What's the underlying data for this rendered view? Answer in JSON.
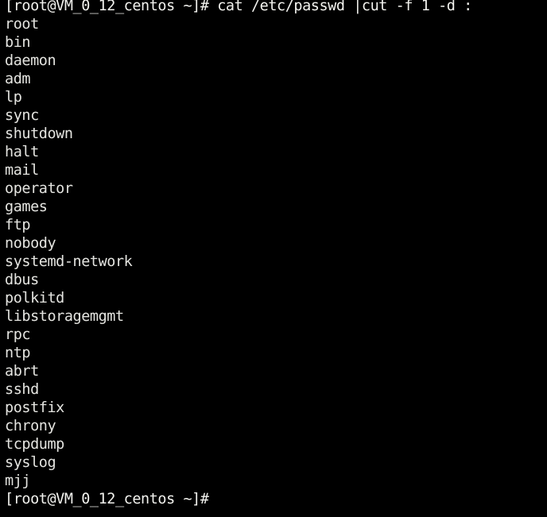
{
  "terminal": {
    "app_name": "terminal",
    "background_color": "#000000",
    "foreground_color": "#e8e8e4",
    "columns": 62,
    "rows": 28,
    "prompt": "[root@VM_0_12_centos ~]#",
    "user": "root",
    "hostname": "VM_0_12_centos",
    "working_directory": "~",
    "lines": [
      {
        "type": "command",
        "text": "[root@VM_0_12_centos ~]# cat /etc/passwd |cut -f 1 -d :"
      },
      {
        "type": "output",
        "text": "root"
      },
      {
        "type": "output",
        "text": "bin"
      },
      {
        "type": "output",
        "text": "daemon"
      },
      {
        "type": "output",
        "text": "adm"
      },
      {
        "type": "output",
        "text": "lp"
      },
      {
        "type": "output",
        "text": "sync"
      },
      {
        "type": "output",
        "text": "shutdown"
      },
      {
        "type": "output",
        "text": "halt"
      },
      {
        "type": "output",
        "text": "mail"
      },
      {
        "type": "output",
        "text": "operator"
      },
      {
        "type": "output",
        "text": "games"
      },
      {
        "type": "output",
        "text": "ftp"
      },
      {
        "type": "output",
        "text": "nobody"
      },
      {
        "type": "output",
        "text": "systemd-network"
      },
      {
        "type": "output",
        "text": "dbus"
      },
      {
        "type": "output",
        "text": "polkitd"
      },
      {
        "type": "output",
        "text": "libstoragemgmt"
      },
      {
        "type": "output",
        "text": "rpc"
      },
      {
        "type": "output",
        "text": "ntp"
      },
      {
        "type": "output",
        "text": "abrt"
      },
      {
        "type": "output",
        "text": "sshd"
      },
      {
        "type": "output",
        "text": "postfix"
      },
      {
        "type": "output",
        "text": "chrony"
      },
      {
        "type": "output",
        "text": "tcpdump"
      },
      {
        "type": "output",
        "text": "syslog"
      },
      {
        "type": "output",
        "text": "mjj"
      },
      {
        "type": "prompt",
        "text": "[root@VM_0_12_centos ~]#"
      }
    ],
    "command": {
      "full": "cat /etc/passwd |cut -f 1 -d :",
      "program": "cat",
      "argument": "/etc/passwd",
      "pipe_program": "cut",
      "pipe_flags": "-f 1 -d :"
    }
  }
}
